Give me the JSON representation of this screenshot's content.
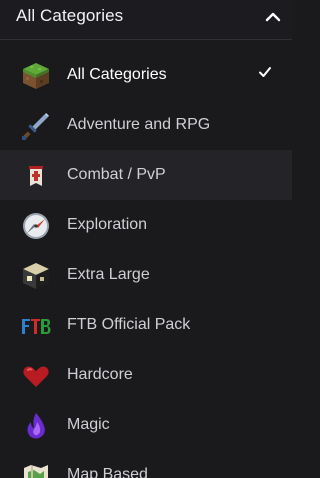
{
  "header": {
    "title": "All Categories",
    "chevron_icon": "chevron-up-icon"
  },
  "categories": [
    {
      "label": "All Categories",
      "icon": "grass-block-icon",
      "selected": true
    },
    {
      "label": "Adventure and RPG",
      "icon": "sword-icon",
      "selected": false
    },
    {
      "label": "Combat / PvP",
      "icon": "banner-icon",
      "selected": false
    },
    {
      "label": "Exploration",
      "icon": "compass-icon",
      "selected": false
    },
    {
      "label": "Extra Large",
      "icon": "dark-block-icon",
      "selected": false
    },
    {
      "label": "FTB Official Pack",
      "icon": "ftb-logo-icon",
      "selected": false
    },
    {
      "label": "Hardcore",
      "icon": "heart-icon",
      "selected": false
    },
    {
      "label": "Magic",
      "icon": "purple-flame-icon",
      "selected": false
    },
    {
      "label": "Map Based",
      "icon": "map-icon",
      "selected": false
    }
  ],
  "colors": {
    "background": "#1a1a1c",
    "hover_row": "#242428",
    "text": "#cfcfd4",
    "selected_text": "#ffffff"
  }
}
